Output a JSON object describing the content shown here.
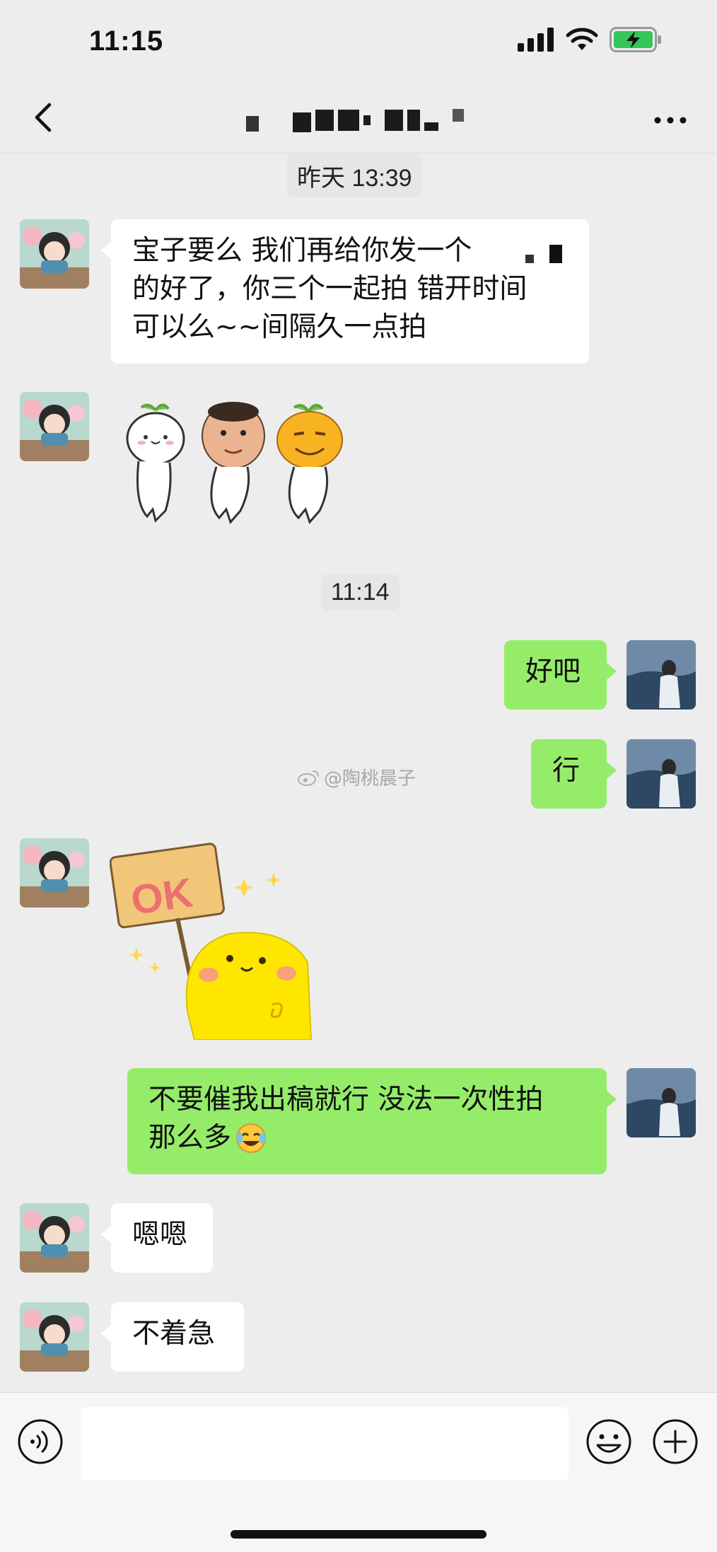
{
  "status": {
    "time": "11:15"
  },
  "nav": {
    "title": "",
    "back_icon": "chevron-left-icon",
    "more_icon": "ellipsis-icon"
  },
  "messages": {
    "ts1": "昨天 13:39",
    "m1": "宝子要么 我们再给你发一个",
    "m1b": "的好了，你三个一起拍 错开时间",
    "m1c": "可以么~~间隔久一点拍",
    "ts2": "11:14",
    "m3": "好吧",
    "m4": "行",
    "m6a": "不要催我出稿就行 没法一次性拍",
    "m6b": "那么多",
    "m7": "嗯嗯",
    "m8": "不着急"
  },
  "watermark": "@陶桃晨子",
  "stickers": {
    "ok_sign_text": "OK"
  },
  "input": {
    "placeholder": ""
  },
  "colors": {
    "background": "#ededed",
    "bubble_self": "#95ec69",
    "bubble_other": "#ffffff"
  }
}
